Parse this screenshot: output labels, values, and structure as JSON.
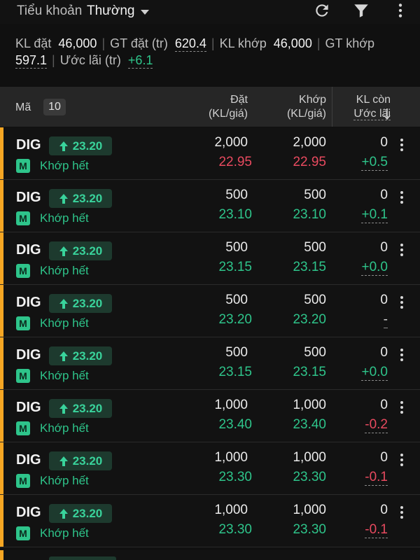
{
  "header": {
    "account_label": "Tiểu khoản",
    "account_value": "Thường"
  },
  "icons": {
    "refresh": "refresh-icon",
    "filter": "filter-icon",
    "more": "more-vertical-icon"
  },
  "summary": {
    "kl_dat_label": "KL đặt",
    "kl_dat_value": "46,000",
    "gt_dat_label": "GT đặt (tr)",
    "gt_dat_value": "620.4",
    "kl_khop_label": "KL khớp",
    "kl_khop_value": "46,000",
    "gt_khop_label": "GT khớp",
    "gt_khop_value": "597.1",
    "uoc_lai_label": "Ước lãi (tr)",
    "uoc_lai_value": "+6.1"
  },
  "table_header": {
    "ma": "Mã",
    "count": "10",
    "dat_line1": "Đặt",
    "dat_line2": "(KL/giá)",
    "khop_line1": "Khớp",
    "khop_line2": "(KL/giá)",
    "klcon_line1": "KL còn",
    "klcon_line2": "Ước lãi"
  },
  "colors": {
    "accent": "#f5a623",
    "up": "#2ec48a",
    "down": "#e84a5f"
  },
  "orders": [
    {
      "symbol": "DIG",
      "ref_price": "23.20",
      "type_badge": "M",
      "status": "Khớp hết",
      "dat_kl": "2,000",
      "dat_price": "22.95",
      "khop_kl": "2,000",
      "khop_price": "22.95",
      "kl_con": "0",
      "uoc_lai": "+0.5",
      "price_color": "red",
      "pl_color": "green"
    },
    {
      "symbol": "DIG",
      "ref_price": "23.20",
      "type_badge": "M",
      "status": "Khớp hết",
      "dat_kl": "500",
      "dat_price": "23.10",
      "khop_kl": "500",
      "khop_price": "23.10",
      "kl_con": "0",
      "uoc_lai": "+0.1",
      "price_color": "green",
      "pl_color": "green"
    },
    {
      "symbol": "DIG",
      "ref_price": "23.20",
      "type_badge": "M",
      "status": "Khớp hết",
      "dat_kl": "500",
      "dat_price": "23.15",
      "khop_kl": "500",
      "khop_price": "23.15",
      "kl_con": "0",
      "uoc_lai": "+0.0",
      "price_color": "green",
      "pl_color": "green"
    },
    {
      "symbol": "DIG",
      "ref_price": "23.20",
      "type_badge": "M",
      "status": "Khớp hết",
      "dat_kl": "500",
      "dat_price": "23.20",
      "khop_kl": "500",
      "khop_price": "23.20",
      "kl_con": "0",
      "uoc_lai": "-",
      "price_color": "green",
      "pl_color": "gray"
    },
    {
      "symbol": "DIG",
      "ref_price": "23.20",
      "type_badge": "M",
      "status": "Khớp hết",
      "dat_kl": "500",
      "dat_price": "23.15",
      "khop_kl": "500",
      "khop_price": "23.15",
      "kl_con": "0",
      "uoc_lai": "+0.0",
      "price_color": "green",
      "pl_color": "green"
    },
    {
      "symbol": "DIG",
      "ref_price": "23.20",
      "type_badge": "M",
      "status": "Khớp hết",
      "dat_kl": "1,000",
      "dat_price": "23.40",
      "khop_kl": "1,000",
      "khop_price": "23.40",
      "kl_con": "0",
      "uoc_lai": "-0.2",
      "price_color": "green",
      "pl_color": "red"
    },
    {
      "symbol": "DIG",
      "ref_price": "23.20",
      "type_badge": "M",
      "status": "Khớp hết",
      "dat_kl": "1,000",
      "dat_price": "23.30",
      "khop_kl": "1,000",
      "khop_price": "23.30",
      "kl_con": "0",
      "uoc_lai": "-0.1",
      "price_color": "green",
      "pl_color": "red"
    },
    {
      "symbol": "DIG",
      "ref_price": "23.20",
      "type_badge": "M",
      "status": "Khớp hết",
      "dat_kl": "1,000",
      "dat_price": "23.30",
      "khop_kl": "1,000",
      "khop_price": "23.30",
      "kl_con": "0",
      "uoc_lai": "-0.1",
      "price_color": "green",
      "pl_color": "red"
    }
  ]
}
